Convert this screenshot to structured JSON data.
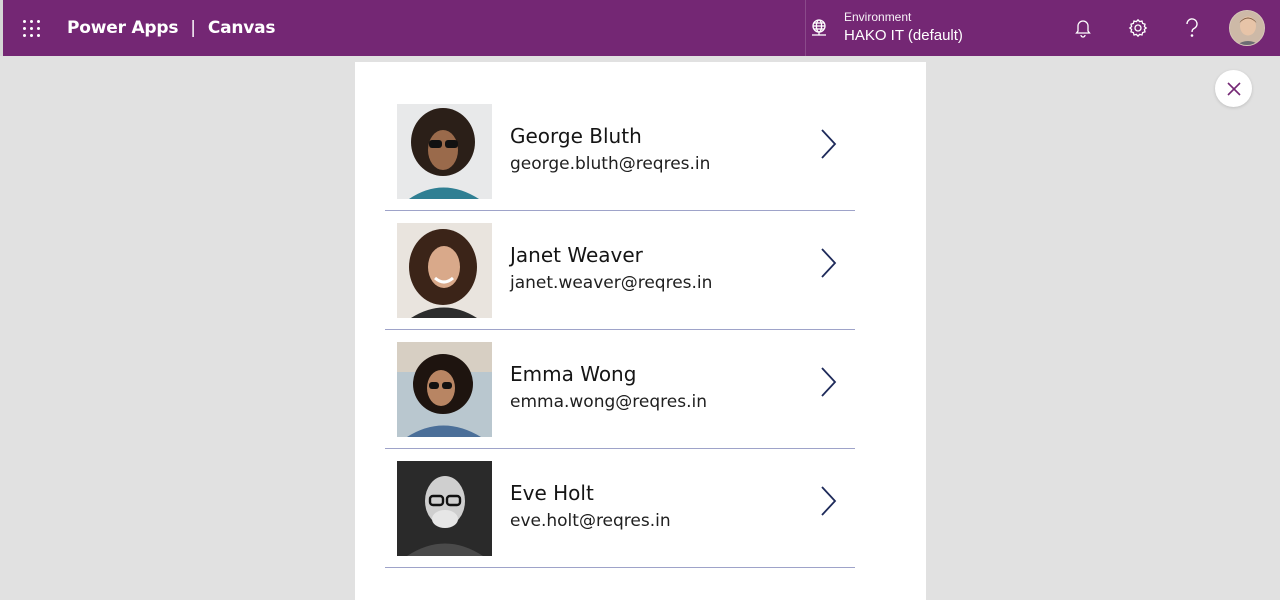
{
  "header": {
    "app_name": "Power Apps",
    "separator": "|",
    "mode": "Canvas",
    "environment_label": "Environment",
    "environment_value": "HAKO IT (default)",
    "brand_color": "#742774"
  },
  "icons": {
    "waffle": "app-launcher-icon",
    "environment": "globe-icon",
    "notifications": "bell-icon",
    "settings": "gear-icon",
    "help": "question-icon",
    "close": "close-icon",
    "row_nav": "chevron-right-icon"
  },
  "gallery": {
    "items": [
      {
        "name": "George Bluth",
        "email": "george.bluth@reqres.in"
      },
      {
        "name": "Janet Weaver",
        "email": "janet.weaver@reqres.in"
      },
      {
        "name": "Emma Wong",
        "email": "emma.wong@reqres.in"
      },
      {
        "name": "Eve Holt",
        "email": "eve.holt@reqres.in"
      }
    ]
  }
}
